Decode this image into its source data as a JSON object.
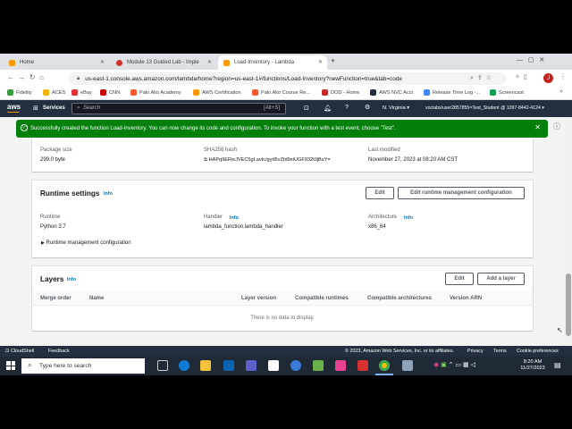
{
  "browser": {
    "tabs": [
      {
        "label": "Home",
        "fav_color": "#ff9900"
      },
      {
        "label": "Module 13 Guided Lab - Imple",
        "fav_color": "#d0342c"
      },
      {
        "label": "Load-Inventory - Lambda",
        "fav_color": "#ff9900"
      }
    ],
    "new_tab": "+",
    "url": "us-east-1.console.aws.amazon.com/lambda/home?region=us-east-1#/functions/Load-Inventory?newFunction=true&tab=code",
    "profile_initial": "J",
    "bookmarks": [
      {
        "label": "Fidelity",
        "color": "#3a9b3e"
      },
      {
        "label": "ACES",
        "color": "#f4b400"
      },
      {
        "label": "eBay",
        "color": "#e53238"
      },
      {
        "label": "CNN",
        "color": "#cc0000"
      },
      {
        "label": "Palo Alto Academy",
        "color": "#fa582d"
      },
      {
        "label": "AWS Certification",
        "color": "#ff9900"
      },
      {
        "label": "Palo Alto Course Re...",
        "color": "#fa582d"
      },
      {
        "label": "DOD - Home",
        "color": "#c62828"
      },
      {
        "label": "AWS NVC Acct",
        "color": "#232f3e"
      },
      {
        "label": "Release Time Log -...",
        "color": "#4285f4"
      },
      {
        "label": "Screencast",
        "color": "#0f9d58"
      }
    ]
  },
  "aws_nav": {
    "logo": "aws",
    "services": "Services",
    "search_placeholder": "Search",
    "search_shortcut": "[Alt+S]",
    "region": "N. Virginia",
    "account": "voclabs/user2857855=Test_Student @ 1097-8442-4124"
  },
  "flash": {
    "message": "Successfully created the function Load-Inventory. You can now change its code and configuration. To invoke your function with a test event, choose \"Test\"."
  },
  "code_props": {
    "package_size_label": "Package size",
    "package_size_value": "299.0 byte",
    "sha_label": "SHA256 hash",
    "sha_value": "HAPq9ERwJVEC5gLavtc/gyd5vZtd9eiUGF932t0jBsY=",
    "modified_label": "Last modified",
    "modified_value": "November 27, 2023 at 08:20 AM CST"
  },
  "runtime": {
    "title": "Runtime settings",
    "info": "Info",
    "edit": "Edit",
    "edit_mgmt": "Edit runtime management configuration",
    "runtime_label": "Runtime",
    "runtime_value": "Python 3.7",
    "handler_label": "Handler",
    "handler_info": "Info",
    "handler_value": "lambda_function.lambda_handler",
    "arch_label": "Architecture",
    "arch_info": "Info",
    "arch_value": "x86_64",
    "mgmt_toggle": "Runtime management configuration"
  },
  "layers": {
    "title": "Layers",
    "info": "Info",
    "edit": "Edit",
    "add": "Add a layer",
    "columns": [
      "Merge order",
      "Name",
      "Layer version",
      "Compatible runtimes",
      "Compatible architectures",
      "Version ARN"
    ],
    "empty": "There is no data to display."
  },
  "footer": {
    "cloudshell": "CloudShell",
    "feedback": "Feedback",
    "copyright": "© 2023, Amazon Web Services, Inc. or its affiliates.",
    "privacy": "Privacy",
    "terms": "Terms",
    "cookies": "Cookie preferences"
  },
  "taskbar": {
    "search_placeholder": "Type here to search",
    "time": "8:20 AM",
    "date": "11/27/2023"
  }
}
